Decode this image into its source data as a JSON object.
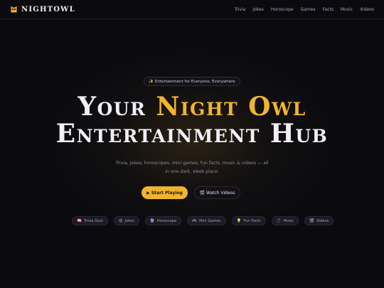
{
  "brand": {
    "name": "NIGHTOWL",
    "icon": "owl-icon"
  },
  "nav": [
    {
      "label": "Trivia"
    },
    {
      "label": "Jokes"
    },
    {
      "label": "Horoscope"
    },
    {
      "label": "Games"
    },
    {
      "label": "Facts"
    },
    {
      "label": "Music"
    },
    {
      "label": "Videos"
    }
  ],
  "hero": {
    "badge": "✨ Entertainment for Everyone, Everywhere",
    "title_part1": "Your ",
    "title_highlight": "Night Owl",
    "title_line2": "Entertainment Hub",
    "subtitle": "Trivia, jokes, horoscopes, mini games, fun facts, music & videos — all in one dark, sleek place.",
    "primary_cta": "▶ Start Playing",
    "secondary_cta": "🎬 Watch Videos"
  },
  "chips": [
    {
      "icon": "🧠",
      "label": "Trivia Quiz"
    },
    {
      "icon": "😄",
      "label": "Jokes"
    },
    {
      "icon": "🔮",
      "label": "Horoscope"
    },
    {
      "icon": "🎮",
      "label": "Mini Games"
    },
    {
      "icon": "💡",
      "label": "Fun Facts"
    },
    {
      "icon": "🎵",
      "label": "Music"
    },
    {
      "icon": "🎬",
      "label": "Videos"
    }
  ],
  "colors": {
    "background": "#0b0b0f",
    "accent": "#f1b42d",
    "text": "#f2eff8",
    "muted": "#8e8aa3"
  }
}
